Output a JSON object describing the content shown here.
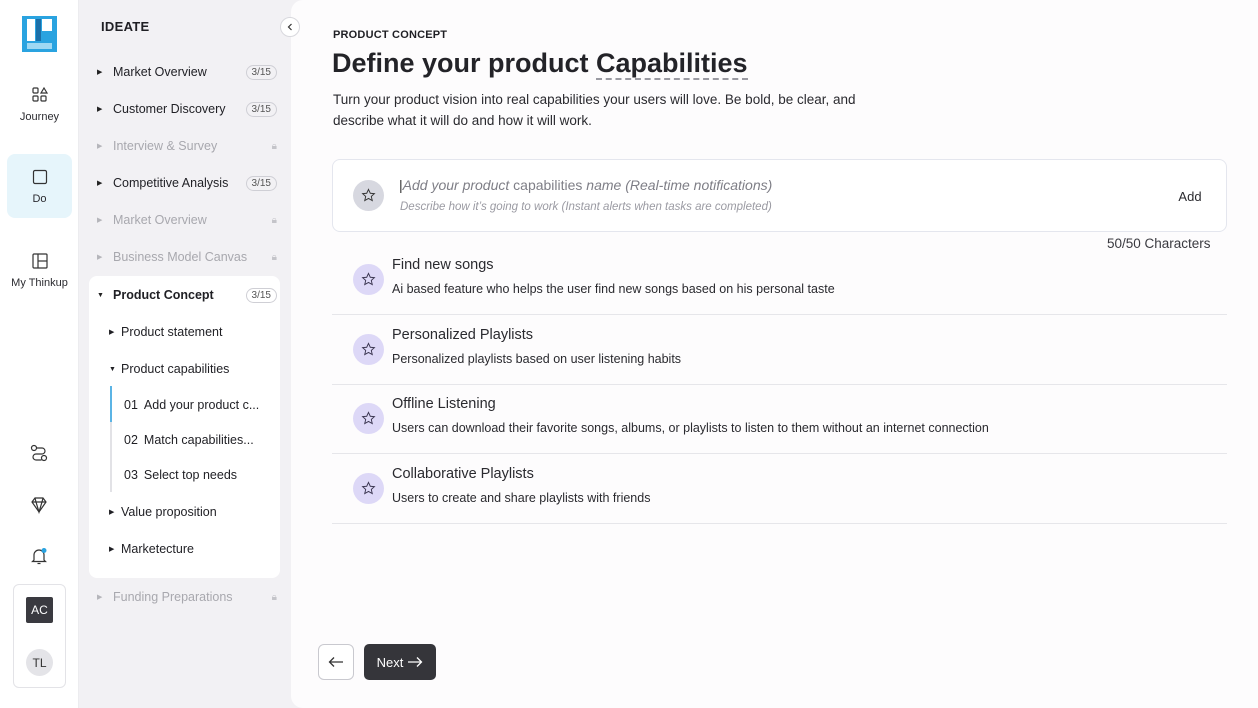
{
  "rail": {
    "items": [
      {
        "label": "Journey",
        "icon": "journey-icon"
      },
      {
        "label": "Do",
        "icon": "do-icon"
      },
      {
        "label": "My Thinkup",
        "icon": "thinkup-icon"
      }
    ],
    "avatars": [
      "AC",
      "TL"
    ]
  },
  "sidebar": {
    "title": "IDEATE",
    "items": [
      {
        "label": "Market Overview",
        "badge": "3/15"
      },
      {
        "label": "Customer Discovery",
        "badge": "3/15"
      },
      {
        "label": "Interview & Survey",
        "locked": true
      },
      {
        "label": "Competitive Analysis",
        "badge": "3/15"
      },
      {
        "label": "Market Overview",
        "locked": true
      },
      {
        "label": "Business Model Canvas",
        "locked": true
      },
      {
        "label": "Product Concept",
        "badge": "3/15"
      },
      {
        "label": "Funding Preparations",
        "locked": true
      }
    ],
    "sub": [
      "Product statement",
      "Product capabilities",
      "Value proposition",
      "Marketecture"
    ],
    "steps": [
      {
        "num": "01",
        "label": "Add your product c..."
      },
      {
        "num": "02",
        "label": "Match capabilities..."
      },
      {
        "num": "03",
        "label": "Select top needs"
      }
    ]
  },
  "main": {
    "eyebrow": "PRODUCT CONCEPT",
    "title_prefix": "Define your product ",
    "title_highlight": "Capabilities",
    "intro": "Turn your product vision into real capabilities your users will love. Be bold, be clear, and describe what it will do and how it will work.",
    "input": {
      "name_part1": "Add your product ",
      "name_part2": "capabilities",
      "name_part3": " name (Real-time notifications)",
      "desc_placeholder": "Describe how it’s going to work (Instant alerts when tasks are completed)",
      "add_label": "Add"
    },
    "char_count": "50/50 Characters",
    "capabilities": [
      {
        "title": "Find new songs",
        "desc": "Ai based feature who helps the user find new songs based on his personal taste"
      },
      {
        "title": "Personalized Playlists",
        "desc": "Personalized playlists based on user listening habits"
      },
      {
        "title": "Offline Listening",
        "desc": "Users can download their favorite songs, albums, or playlists to listen to them without an internet connection"
      },
      {
        "title": "Collaborative Playlists",
        "desc": "Users to create and share playlists with friends"
      }
    ],
    "next_label": "Next"
  },
  "colors": {
    "accent": "#5bb4e5",
    "primary_button": "#35353a",
    "star_bg": "#ddd8f7",
    "active_rail": "#e6f5fb"
  }
}
